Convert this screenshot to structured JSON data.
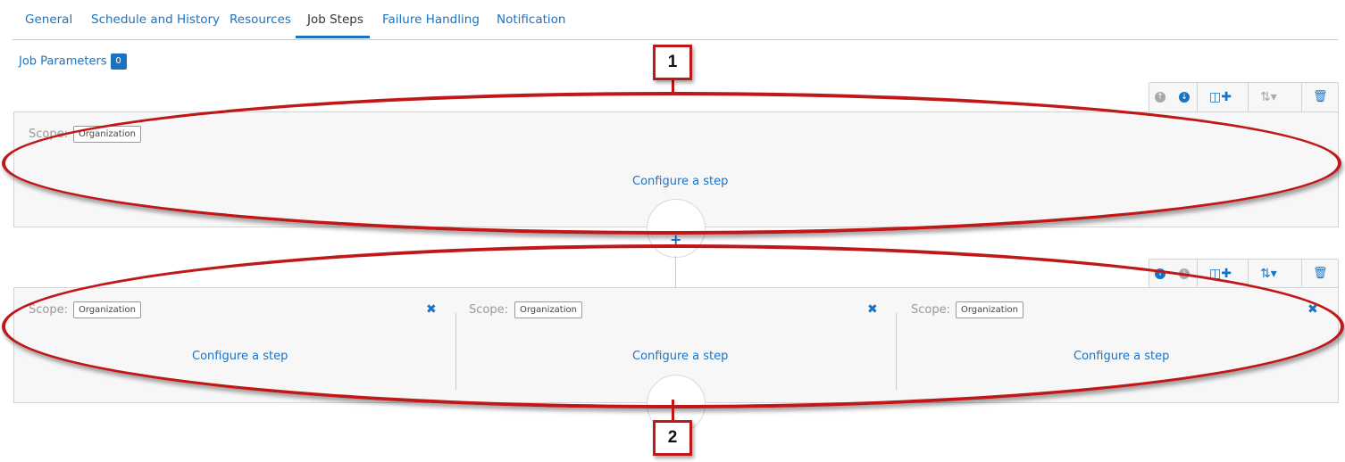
{
  "tabs": [
    {
      "label": "General",
      "active": false
    },
    {
      "label": "Schedule and History",
      "active": false
    },
    {
      "label": "Resources",
      "active": false
    },
    {
      "label": "Job Steps",
      "active": true
    },
    {
      "label": "Failure Handling",
      "active": false
    },
    {
      "label": "Notification",
      "active": false
    }
  ],
  "job_parameters": {
    "label": "Job Parameters",
    "count": "0"
  },
  "steps": {
    "scope_label": "Scope:",
    "scope_value": "Organization",
    "configure_label": "Configure a step",
    "close_glyph": "✖"
  },
  "toolbar_icons": [
    "move-up-icon",
    "move-down-icon",
    "add-parallel-step-icon",
    "sort-icon",
    "delete-icon"
  ],
  "connector": {
    "add_glyph": "+"
  },
  "annotations": {
    "callout_1": "1",
    "callout_2": "2"
  },
  "colors": {
    "accent": "#1a73c2",
    "annotation": "#c01818",
    "panel_bg": "#f7f7f7",
    "disabled": "#a8a8a8"
  }
}
